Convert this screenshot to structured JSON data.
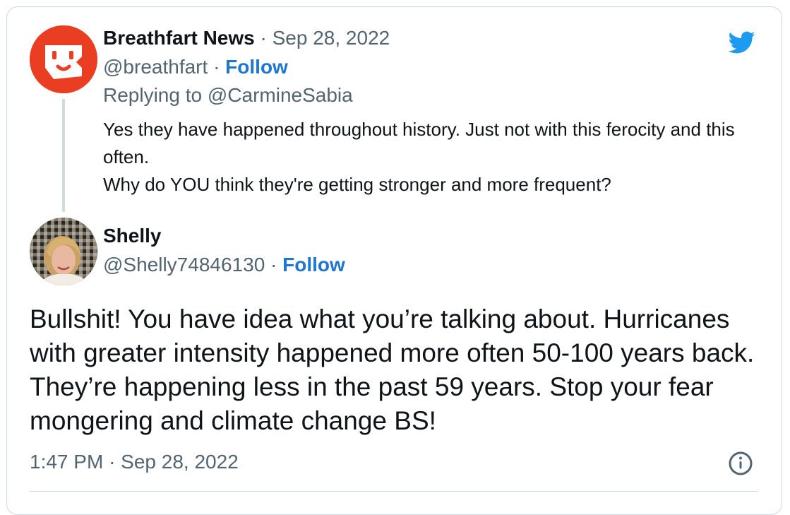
{
  "parent_tweet": {
    "author_name": "Breathfart News",
    "date": "Sep 28, 2022",
    "handle": "@breathfart",
    "follow_label": "Follow",
    "replying_to_label": "Replying to @CarmineSabia",
    "text_line1": "Yes they have happened throughout history. Just not with this ferocity and this often.",
    "text_line2": "Why do YOU think they're getting stronger and more frequent?",
    "avatar_color": "#ea3e22"
  },
  "reply_tweet": {
    "author_name": "Shelly",
    "handle": "@Shelly74846130",
    "follow_label": "Follow",
    "text": "Bullshit! You have idea what you’re talking about. Hurricanes with greater intensity happened more often 50-100 years back. They’re happening less in the past 59 years. Stop your fear mongering and climate change BS!",
    "time": "1:47 PM",
    "date": "Sep 28, 2022"
  },
  "separator": "·",
  "colors": {
    "brand_blue": "#1d9bf0",
    "link_blue": "#1d76d1",
    "muted_text": "#536471",
    "border": "#cfd9de"
  },
  "icons": {
    "brand": "twitter-bird-icon",
    "info": "info-icon"
  }
}
